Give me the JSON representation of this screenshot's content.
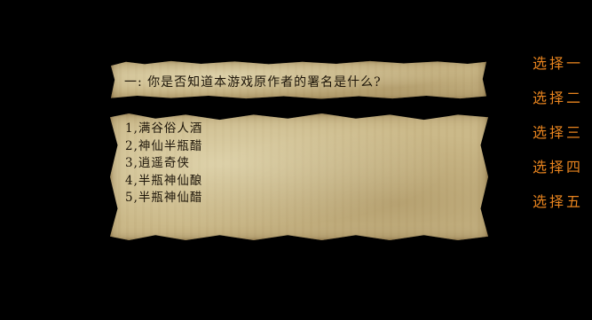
{
  "question": {
    "text": "一: 你是否知道本游戏原作者的署名是什么?"
  },
  "answers": [
    "1,满谷俗人酒",
    "2,神仙半瓶醋",
    "3,逍遥奇侠",
    "4,半瓶神仙酿",
    "5,半瓶神仙醋"
  ],
  "choices": [
    "选择一",
    "选择二",
    "选择三",
    "选择四",
    "选择五"
  ],
  "colors": {
    "background": "#000000",
    "parchment": "#cbb989",
    "choice_text": "#e8841e",
    "ink": "#1c1408"
  }
}
